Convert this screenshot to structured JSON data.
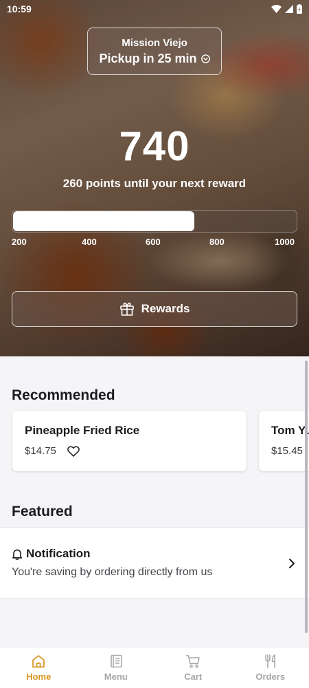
{
  "status": {
    "time": "10:59"
  },
  "location": {
    "name": "Mission Viejo",
    "pickup": "Pickup in 25 min"
  },
  "rewards": {
    "points": "740",
    "subtitle": "260 points until your next reward",
    "progress_fraction": 0.64,
    "scale_labels": [
      "200",
      "400",
      "600",
      "800",
      "1000"
    ],
    "button_label": "Rewards"
  },
  "recommended": {
    "title": "Recommended",
    "items": [
      {
        "name": "Pineapple Fried Rice",
        "price": "$14.75"
      },
      {
        "name": "Tom Yum Soup",
        "price": "$15.45"
      }
    ]
  },
  "featured": {
    "title": "Featured",
    "notification": {
      "title": "Notification",
      "message": "You're saving by ordering directly from us"
    }
  },
  "nav": {
    "items": [
      {
        "label": "Home",
        "icon": "home-icon"
      },
      {
        "label": "Menu",
        "icon": "menu-book-icon"
      },
      {
        "label": "Cart",
        "icon": "cart-icon"
      },
      {
        "label": "Orders",
        "icon": "fork-knife-icon"
      }
    ],
    "active_index": 0
  },
  "colors": {
    "accent": "#d8941f",
    "inactive": "#a8a6ab",
    "background": "#f5f4f6"
  }
}
